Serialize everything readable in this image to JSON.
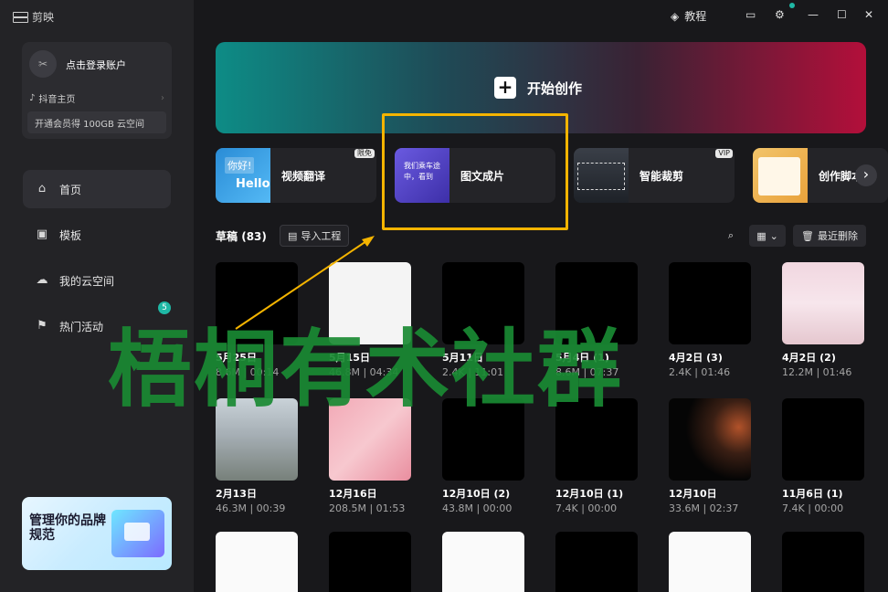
{
  "app": {
    "name": "剪映"
  },
  "topbar": {
    "tutorial": "教程"
  },
  "account": {
    "login": "点击登录账户",
    "douyin": "抖音主页",
    "member": "开通会员得 100GB 云空间"
  },
  "nav": [
    {
      "label": "首页",
      "icon": "home-icon",
      "active": true
    },
    {
      "label": "模板",
      "icon": "template-icon"
    },
    {
      "label": "我的云空间",
      "icon": "cloud-icon"
    },
    {
      "label": "热门活动",
      "icon": "flag-icon",
      "badge": "5"
    }
  ],
  "promo": {
    "text": "管理你的品牌规范"
  },
  "hero": {
    "label": "开始创作"
  },
  "tools": [
    {
      "label": "视频翻译",
      "tag": "限免",
      "thumb_text1": "你好!",
      "thumb_text2": "Hello"
    },
    {
      "label": "图文成片",
      "thumb_text": "我们乘车途中，看到"
    },
    {
      "label": "智能裁剪",
      "tag": "VIP"
    },
    {
      "label": "创作脚本"
    }
  ],
  "drafts": {
    "title": "草稿",
    "count": "(83)",
    "import": "导入工程",
    "recent_delete": "最近删除"
  },
  "cards": [
    {
      "name": "5月25日",
      "meta": "8.6M | 00:14",
      "style": "black"
    },
    {
      "name": "5月15日",
      "meta": "46.8M | 04:34",
      "style": "white"
    },
    {
      "name": "5月11日",
      "meta": "2.4K | 11:01",
      "style": "black"
    },
    {
      "name": "5月4日 (1)",
      "meta": "8.6M | 07:37",
      "style": "black"
    },
    {
      "name": "4月2日 (3)",
      "meta": "2.4K | 01:46",
      "style": "black"
    },
    {
      "name": "4月2日 (2)",
      "meta": "12.2M | 01:46",
      "style": "girl"
    },
    {
      "name": "2月13日",
      "meta": "46.3M | 00:39",
      "style": "street"
    },
    {
      "name": "12月16日",
      "meta": "208.5M | 01:53",
      "style": "phone"
    },
    {
      "name": "12月10日 (2)",
      "meta": "43.8M | 00:00",
      "style": "black"
    },
    {
      "name": "12月10日 (1)",
      "meta": "7.4K | 00:00",
      "style": "black"
    },
    {
      "name": "12月10日",
      "meta": "33.6M | 02:37",
      "style": "dark"
    },
    {
      "name": "11月6日 (1)",
      "meta": "7.4K | 00:00",
      "style": "black"
    }
  ],
  "row3": [
    "doc",
    "black",
    "doc",
    "black",
    "doc",
    "black"
  ],
  "watermark": "梧桐有术社群",
  "colors": {
    "highlight": "#f4b400",
    "accent": "#1fb8a5"
  }
}
